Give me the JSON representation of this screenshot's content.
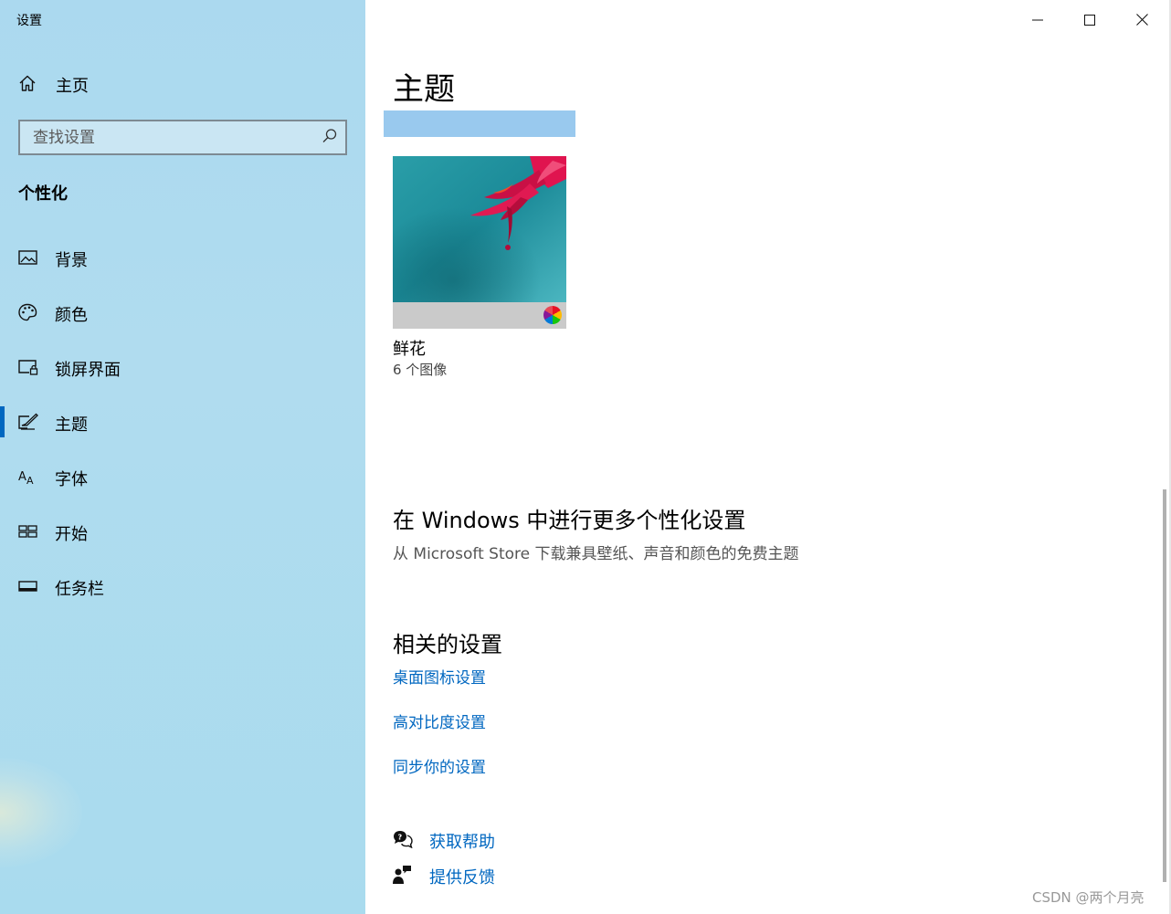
{
  "window": {
    "title": "设置"
  },
  "sidebar": {
    "home_label": "主页",
    "search_placeholder": "查找设置",
    "section_title": "个性化",
    "items": [
      {
        "label": "背景",
        "icon": "picture-icon"
      },
      {
        "label": "颜色",
        "icon": "palette-icon"
      },
      {
        "label": "锁屏界面",
        "icon": "lock-screen-icon"
      },
      {
        "label": "主题",
        "icon": "theme-edit-icon",
        "selected": true
      },
      {
        "label": "字体",
        "icon": "font-icon"
      },
      {
        "label": "开始",
        "icon": "start-tiles-icon"
      },
      {
        "label": "任务栏",
        "icon": "taskbar-icon"
      }
    ]
  },
  "main": {
    "page_title": "主题",
    "theme": {
      "name": "鲜花",
      "count": "6 个图像"
    },
    "more": {
      "title": "在 Windows 中进行更多个性化设置",
      "link": "从 Microsoft Store 下载兼具壁纸、声音和颜色的免费主题"
    },
    "related": {
      "title": "相关的设置",
      "links": [
        "桌面图标设置",
        "高对比度设置",
        "同步你的设置"
      ]
    },
    "help": {
      "get_help": "获取帮助",
      "feedback": "提供反馈"
    }
  },
  "watermark": "CSDN @两个月亮",
  "colors": {
    "accent": "#0067c0",
    "sidebar_bg": "#abd9ef",
    "selected_bar": "#99c9ee"
  }
}
